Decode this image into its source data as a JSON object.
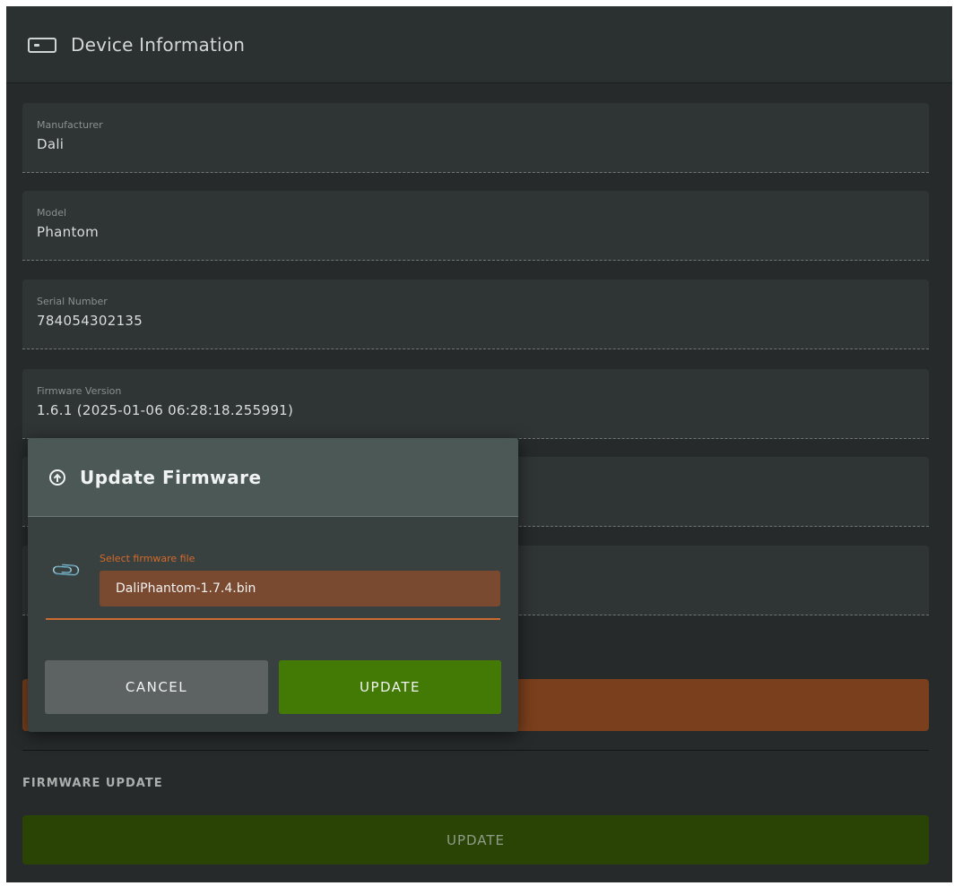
{
  "header": {
    "title": "Device Information",
    "icon": "device-icon"
  },
  "fields": [
    {
      "label": "Manufacturer",
      "value": "Dali"
    },
    {
      "label": "Model",
      "value": "Phantom"
    },
    {
      "label": "Serial Number",
      "value": "784054302135"
    },
    {
      "label": "Firmware Version",
      "value": "1.6.1  (2025-01-06 06:28:18.255991)"
    }
  ],
  "firmware_section": {
    "label": "FIRMWARE UPDATE",
    "update_label": "UPDATE"
  },
  "dialog": {
    "title": "Update Firmware",
    "icon": "arrow-up-circle-icon",
    "file_label": "Select firmware file",
    "file_value": "DaliPhantom-1.7.4.bin",
    "file_icon": "paperclip-icon",
    "cancel_label": "CANCEL",
    "update_label": "UPDATE"
  },
  "colors": {
    "accent_orange": "#c96a30",
    "update_green": "#437a06",
    "background": "#262a2a"
  }
}
